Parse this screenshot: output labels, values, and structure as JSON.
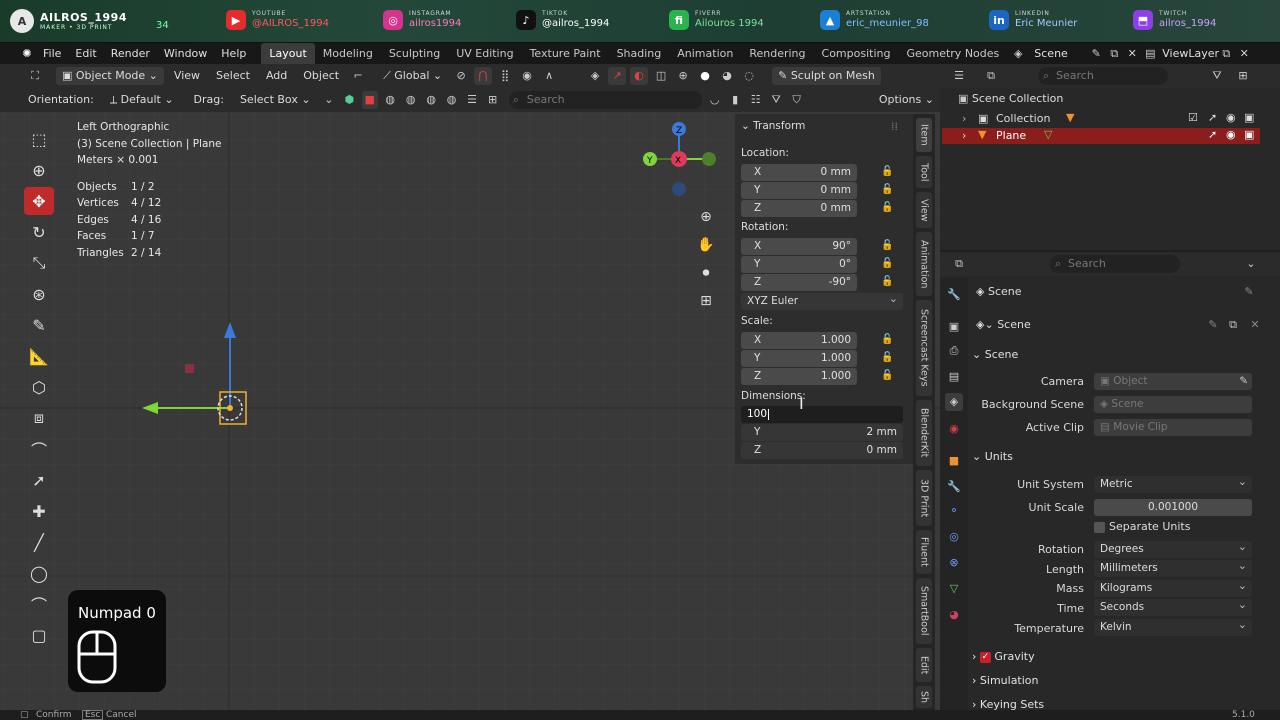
{
  "social": {
    "brand_name": "AILROS_1994",
    "brand_sub": "MAKER • 3D PRINT",
    "logo_letter": "A",
    "partial": "34",
    "items": [
      {
        "platform": "YOUTUBE",
        "handle": "@AILROS_1994",
        "color": "#e62b2b",
        "icon": "youtube-icon"
      },
      {
        "platform": "INSTAGRAM",
        "handle": "ailros1994",
        "color": "#d6338f",
        "icon": "instagram-icon"
      },
      {
        "platform": "TIKTOK",
        "handle": "@ailros_1994",
        "color": "#111111",
        "icon": "tiktok-icon"
      },
      {
        "platform": "FIVERR",
        "handle": "Ailouros 1994",
        "color": "#2bb34e",
        "icon": "fiverr-icon"
      },
      {
        "platform": "ARTSTATION",
        "handle": "eric_meunier_98",
        "color": "#1b7fd6",
        "icon": "artstation-icon"
      },
      {
        "platform": "LINKEDIN",
        "handle": "Eric Meunier",
        "color": "#1a66c2",
        "icon": "linkedin-icon"
      },
      {
        "platform": "TWITCH",
        "handle": "ailros_1994",
        "color": "#8f3fe8",
        "icon": "twitch-icon"
      }
    ]
  },
  "menubar": {
    "items": [
      "File",
      "Edit",
      "Render",
      "Window",
      "Help"
    ],
    "workspaces": [
      "Layout",
      "Modeling",
      "Sculpting",
      "UV Editing",
      "Texture Paint",
      "Shading",
      "Animation",
      "Rendering",
      "Compositing",
      "Geometry Nodes"
    ],
    "active_workspace": "Layout",
    "scene": "Scene",
    "view_layer": "ViewLayer"
  },
  "viewport_header": {
    "mode": "Object Mode",
    "menus": [
      "View",
      "Select",
      "Add",
      "Object"
    ],
    "transform_orientation": "Global",
    "sculpt_button": "Sculpt on Mesh",
    "orientation_label": "Orientation:",
    "orientation_value": "Default",
    "drag_label": "Drag:",
    "drag_value": "Select Box",
    "search_placeholder": "Search",
    "options": "Options"
  },
  "overlay": {
    "view_name": "Left Orthographic",
    "collection_path": "(3) Scene Collection | Plane",
    "units": "Meters × 0.001",
    "stats": [
      {
        "label": "Objects",
        "value": "1 / 2"
      },
      {
        "label": "Vertices",
        "value": "4 / 12"
      },
      {
        "label": "Edges",
        "value": "4 / 16"
      },
      {
        "label": "Faces",
        "value": "1 / 7"
      },
      {
        "label": "Triangles",
        "value": "2 / 14"
      }
    ]
  },
  "npanel": {
    "title": "Transform",
    "location_label": "Location:",
    "location": [
      {
        "axis": "X",
        "value": "0 mm"
      },
      {
        "axis": "Y",
        "value": "0 mm"
      },
      {
        "axis": "Z",
        "value": "0 mm"
      }
    ],
    "rotation_label": "Rotation:",
    "rotation": [
      {
        "axis": "X",
        "value": "90°"
      },
      {
        "axis": "Y",
        "value": "0°"
      },
      {
        "axis": "Z",
        "value": "-90°"
      }
    ],
    "rotation_mode": "XYZ Euler",
    "scale_label": "Scale:",
    "scale": [
      {
        "axis": "X",
        "value": "1.000"
      },
      {
        "axis": "Y",
        "value": "1.000"
      },
      {
        "axis": "Z",
        "value": "1.000"
      }
    ],
    "dimensions_label": "Dimensions:",
    "dimension_edit": "100",
    "dimensions": [
      {
        "axis": "Y",
        "value": "2 mm"
      },
      {
        "axis": "Z",
        "value": "0 mm"
      }
    ]
  },
  "side_tabs": [
    "Item",
    "Tool",
    "View",
    "Animation",
    "Screencast Keys",
    "BlenderKit",
    "3D Print",
    "Fluent",
    "SmartBool",
    "Edit",
    "Sh"
  ],
  "keycast": {
    "text": "Numpad 0"
  },
  "outliner": {
    "search_placeholder": "Search",
    "root": "Scene Collection",
    "items": [
      {
        "name": "Collection",
        "selected": false
      },
      {
        "name": "Plane",
        "selected": true
      }
    ]
  },
  "properties": {
    "search_placeholder": "Search",
    "breadcrumb": "Scene",
    "datablock": "Scene",
    "scene_section": "Scene",
    "camera_label": "Camera",
    "camera_placeholder": "Object",
    "bg_scene_label": "Background Scene",
    "bg_scene_placeholder": "Scene",
    "active_clip_label": "Active Clip",
    "active_clip_placeholder": "Movie Clip",
    "units_section": "Units",
    "unit_system_label": "Unit System",
    "unit_system": "Metric",
    "unit_scale_label": "Unit Scale",
    "unit_scale": "0.001000",
    "separate_units": "Separate Units",
    "rotation_label": "Rotation",
    "rotation": "Degrees",
    "length_label": "Length",
    "length": "Millimeters",
    "mass_label": "Mass",
    "mass": "Kilograms",
    "time_label": "Time",
    "time": "Seconds",
    "temperature_label": "Temperature",
    "temperature": "Kelvin",
    "gravity": "Gravity",
    "simulation": "Simulation",
    "keying_sets": "Keying Sets"
  },
  "statusbar": {
    "confirm": "Confirm",
    "cancel": "Cancel",
    "esc": "Esc",
    "version": "5.1.0"
  }
}
